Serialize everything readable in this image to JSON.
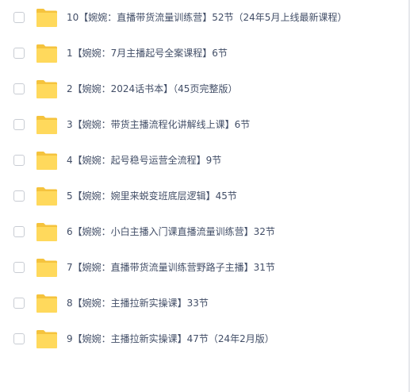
{
  "file_list": {
    "items": [
      {
        "name": "10【婉婉：直播带货流量训练营】52节（24年5月上线最新课程）",
        "icon": "folder-icon"
      },
      {
        "name": "1【婉婉：7月主播起号全案课程】6节",
        "icon": "folder-icon"
      },
      {
        "name": "2【婉婉：2024话书本】（45页完整版）",
        "icon": "folder-icon"
      },
      {
        "name": "3【婉婉：带货主播流程化讲解线上课】6节",
        "icon": "folder-icon"
      },
      {
        "name": "4【婉婉：起号稳号运营全流程】9节",
        "icon": "folder-icon"
      },
      {
        "name": "5【婉婉：婉里来蜕变班底层逻辑】45节",
        "icon": "folder-icon"
      },
      {
        "name": "6【婉婉：小白主播入门课直播流量训练营】32节",
        "icon": "folder-icon"
      },
      {
        "name": "7【婉婉：直播带货流量训练营野路子主播】31节",
        "icon": "folder-icon"
      },
      {
        "name": "8【婉婉：主播拉新实操课】33节",
        "icon": "folder-icon"
      },
      {
        "name": "9【婉婉：主播拉新实操课】47节（24年2月版）",
        "icon": "folder-icon"
      }
    ]
  },
  "colors": {
    "folder_back": "#f5c33d",
    "folder_front": "#ffd95c",
    "text": "#424e67",
    "checkbox_border": "#c8ccd3"
  }
}
